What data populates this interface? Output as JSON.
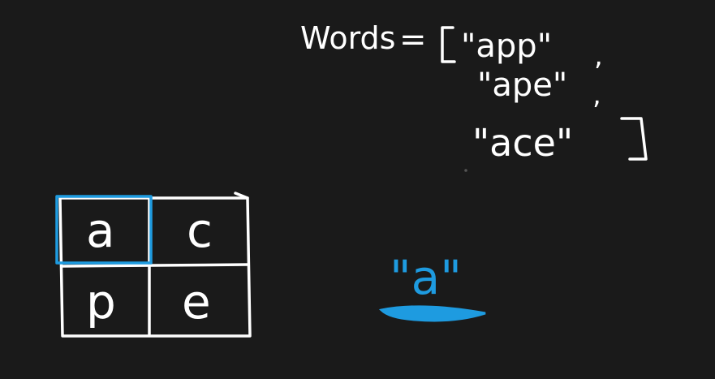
{
  "words_list": {
    "label": "Words",
    "equals": "=",
    "open_bracket": "[",
    "close_bracket": "]",
    "items": [
      {
        "text": "\"app\"",
        "separator": ","
      },
      {
        "text": "\"ape\"",
        "separator": ","
      },
      {
        "text": "\"ace\"",
        "separator": ""
      }
    ]
  },
  "board": {
    "cells": [
      [
        "a",
        "c"
      ],
      [
        "p",
        "e"
      ]
    ],
    "highlighted_cell": "a"
  },
  "current_prefix": {
    "text": "\"a\""
  },
  "colors": {
    "background": "#1a1a1a",
    "ink": "#ffffff",
    "highlight": "#1e9be0"
  }
}
